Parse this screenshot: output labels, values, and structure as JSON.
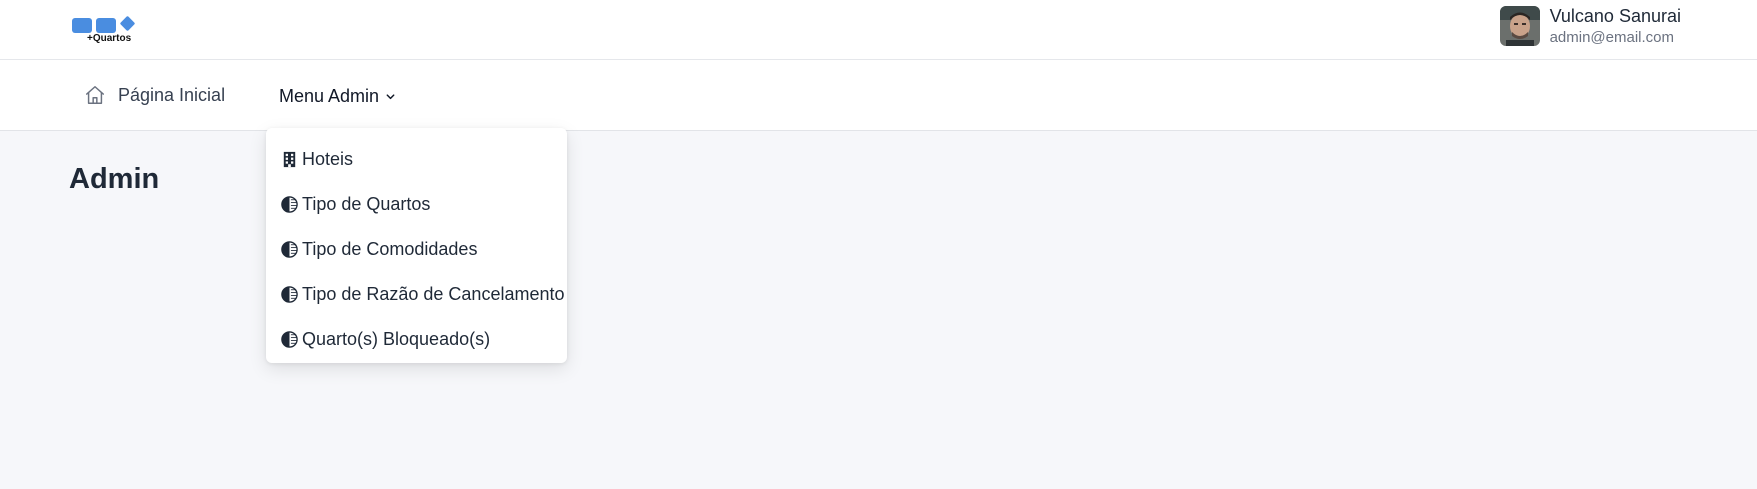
{
  "header": {
    "logo_text": "+Quartos",
    "user": {
      "name": "Vulcano Sanurai",
      "email": "admin@email.com"
    }
  },
  "nav": {
    "home_label": "Página Inicial",
    "admin_menu_label": "Menu Admin"
  },
  "main": {
    "title": "Admin"
  },
  "admin_menu": {
    "items": [
      {
        "label": "Hoteis",
        "icon": "building-icon"
      },
      {
        "label": "Tipo de Quartos",
        "icon": "half-circle-icon"
      },
      {
        "label": "Tipo de Comodidades",
        "icon": "half-circle-icon"
      },
      {
        "label": "Tipo de Razão de Cancelamento",
        "icon": "half-circle-icon"
      },
      {
        "label": "Quarto(s) Bloqueado(s)",
        "icon": "half-circle-icon"
      }
    ]
  },
  "colors": {
    "logo_blue": "#4a8de0",
    "page_background": "#f6f7fa",
    "text_dark": "#1f2937",
    "text_muted": "#6b7280"
  }
}
